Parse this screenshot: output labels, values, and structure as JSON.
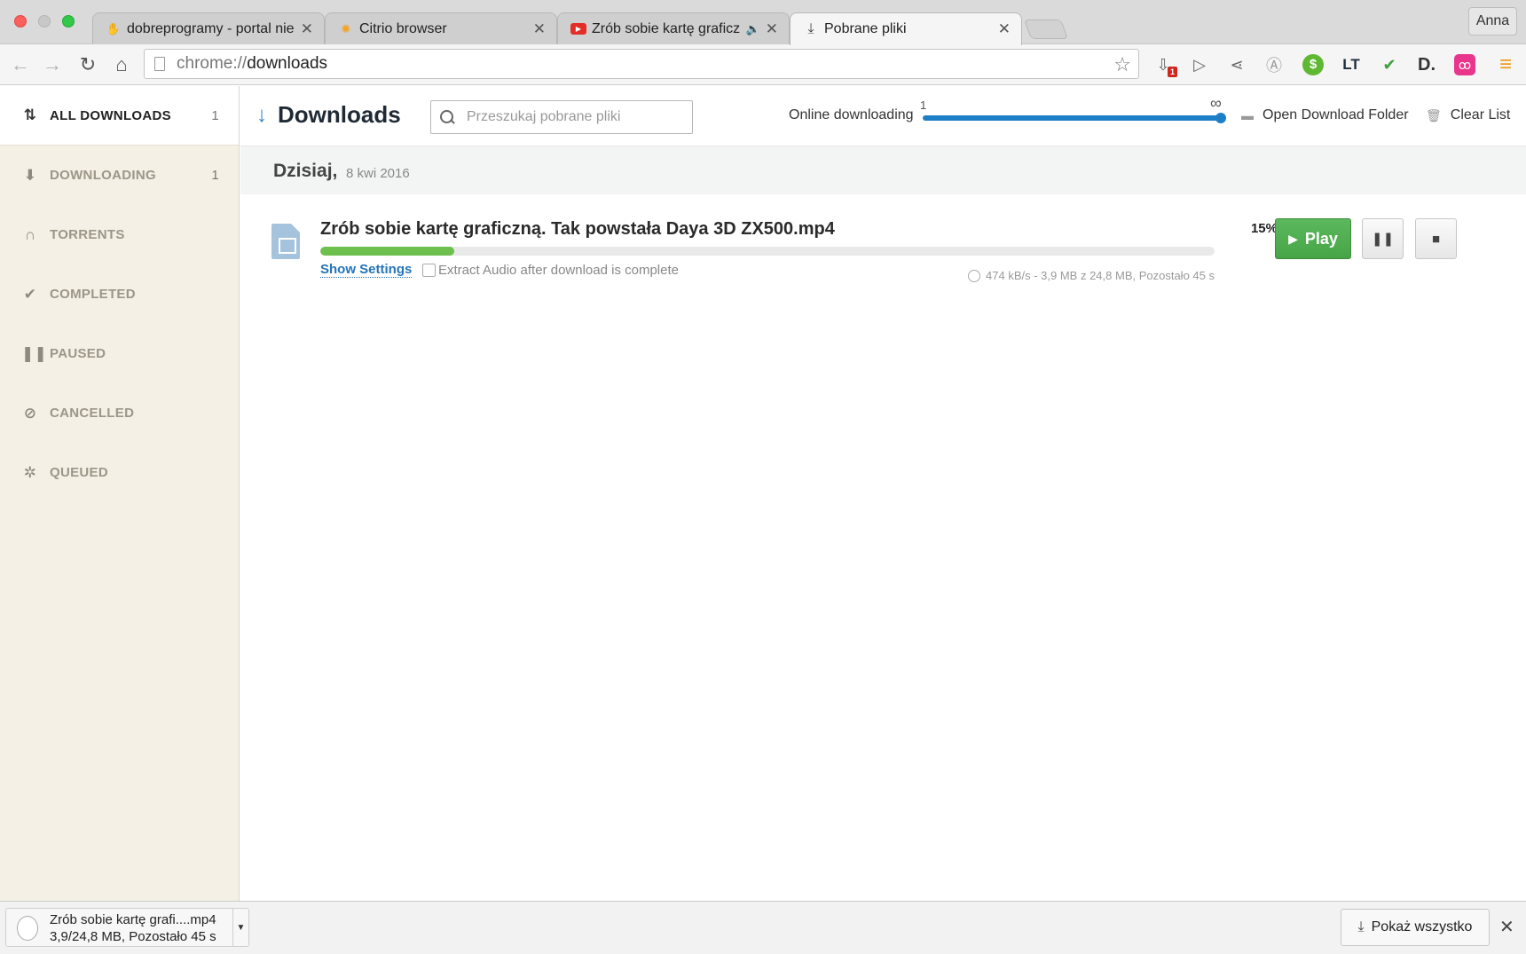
{
  "tabs": [
    {
      "label": "dobreprogramy - portal nie",
      "icon": "dobreprogramy-icon"
    },
    {
      "label": "Citrio browser",
      "icon": "citrio-icon"
    },
    {
      "label": "Zrób sobie kartę graficz",
      "icon": "youtube-icon",
      "sound": true
    },
    {
      "label": "Pobrane pliki",
      "icon": "download-icon",
      "active": true
    }
  ],
  "user": "Anna",
  "omnibox": {
    "scheme": "chrome://",
    "path": "downloads"
  },
  "extensions": [
    {
      "name": "download-ext-icon",
      "glyph": "⇩",
      "badge": "1"
    },
    {
      "name": "play-ext-icon",
      "glyph": "▷"
    },
    {
      "name": "share-ext-icon",
      "glyph": "⋖"
    },
    {
      "name": "adblock-ext-icon",
      "glyph": "Ⓐ"
    },
    {
      "name": "dollar-ext-icon",
      "glyph": "$"
    },
    {
      "name": "lt-ext-icon",
      "glyph": "LT"
    },
    {
      "name": "abc-check-ext-icon",
      "glyph": "✔"
    },
    {
      "name": "d-ext-icon",
      "glyph": "D."
    },
    {
      "name": "pink-ext-icon",
      "glyph": "ꝏ"
    },
    {
      "name": "menu-icon",
      "glyph": "≡"
    }
  ],
  "sidebar": {
    "items": [
      {
        "label": "ALL DOWNLOADS",
        "count": "1",
        "icon": "sort-icon"
      },
      {
        "label": "DOWNLOADING",
        "count": "1",
        "icon": "download-arrow-icon"
      },
      {
        "label": "TORRENTS",
        "count": "",
        "icon": "magnet-icon"
      },
      {
        "label": "COMPLETED",
        "count": "",
        "icon": "checkmark-icon"
      },
      {
        "label": "PAUSED",
        "count": "",
        "icon": "pause-icon"
      },
      {
        "label": "CANCELLED",
        "count": "",
        "icon": "cancel-icon"
      },
      {
        "label": "QUEUED",
        "count": "",
        "icon": "spinner-icon"
      }
    ]
  },
  "header": {
    "title": "Downloads",
    "search_placeholder": "Przeszukaj pobrane pliki",
    "online_label": "Online downloading",
    "slider_min": "1",
    "slider_max": "∞",
    "open_folder": "Open Download Folder",
    "clear_list": "Clear List"
  },
  "group": {
    "day": "Dzisiaj,",
    "date": "8 kwi 2016"
  },
  "download": {
    "filename": "Zrób sobie kartę graficzną. Tak powstała Daya 3D ZX500.mp4",
    "percent_label": "15%",
    "progress": 0.15,
    "show_settings": "Show Settings",
    "extract_audio": "Extract Audio after download is complete",
    "stats": "474 kB/s - 3,9 MB z 24,8 MB, Pozostało 45 s",
    "play_label": "Play"
  },
  "shelf": {
    "name": "Zrób sobie kartę grafi....mp4",
    "status": "3,9/24,8 MB, Pozostało 45 s",
    "show_all": "Pokaż wszystko"
  },
  "colors": {
    "accent": "#2a7fc4",
    "progress": "#6dbf4e",
    "play": "#5cb85c",
    "sidebar_bg": "#f4f0e6"
  }
}
